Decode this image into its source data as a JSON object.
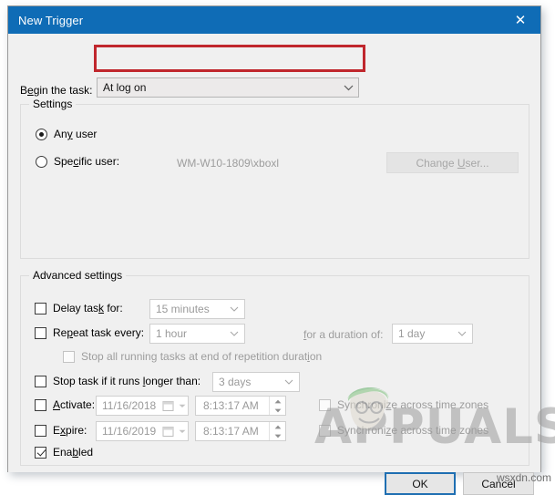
{
  "window": {
    "title": "New Trigger",
    "close_icon": "close-icon"
  },
  "begin": {
    "label_pre": "B",
    "label_accel": "e",
    "label_post": "gin the task:",
    "value": "At log on",
    "chevron": "chevron-down-icon",
    "annotation_color": "#c0272d"
  },
  "settings": {
    "title": "Settings",
    "any_user": {
      "pre": "An",
      "accel": "y",
      "post": " user",
      "checked": true
    },
    "specific_user": {
      "pre": "Spe",
      "accel": "c",
      "post": "ific user:",
      "checked": false
    },
    "user_value": "WM-W10-1809\\xboxl",
    "change_user": {
      "pre": "Change ",
      "accel": "U",
      "post": "ser...",
      "enabled": false
    }
  },
  "advanced": {
    "title": "Advanced settings",
    "delay_task": {
      "pre": "Delay tas",
      "accel": "k",
      "post": " for:",
      "checked": false,
      "value": "15 minutes"
    },
    "repeat_task": {
      "pre": "Re",
      "accel": "p",
      "post": "eat task every:",
      "checked": false,
      "value": "1 hour"
    },
    "duration": {
      "pre": "",
      "accel": "f",
      "post": "or a duration of:",
      "value": "1 day"
    },
    "stop_all_running": {
      "pre": "Stop all running tasks at end of repetition durat",
      "accel": "i",
      "post": "on",
      "checked": false
    },
    "stop_task_longer": {
      "pre": "Stop task if it runs ",
      "accel": "l",
      "post": "onger than:",
      "checked": false,
      "value": "3 days"
    },
    "activate": {
      "pre": "",
      "accel": "A",
      "post": "ctivate:",
      "checked": false,
      "date": "11/16/2018",
      "time": "8:13:17 AM",
      "sync": {
        "pre": "Synchroni",
        "accel": "z",
        "post": "e across time zones",
        "checked": false
      }
    },
    "expire": {
      "pre": "E",
      "accel": "x",
      "post": "pire:",
      "checked": false,
      "date": "11/16/2019",
      "time": "8:13:17 AM",
      "sync": {
        "pre": "Synchroni",
        "accel": "z",
        "post": "e across time zones",
        "checked": false
      }
    },
    "enabled": {
      "pre": "Ena",
      "accel": "b",
      "post": "led",
      "checked": true
    }
  },
  "footer": {
    "ok": "OK",
    "cancel": "Cancel"
  },
  "watermarks": {
    "appuals": "APPUALS",
    "wsxdn": "wsxdn.com"
  }
}
